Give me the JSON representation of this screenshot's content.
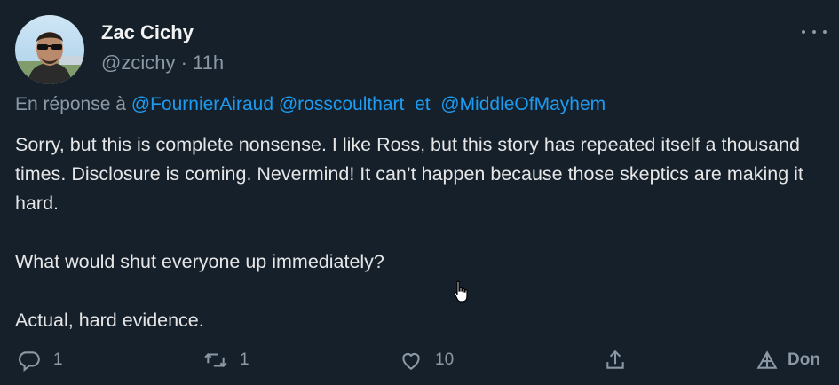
{
  "author": {
    "name": "Zac Cichy",
    "handle": "@zcichy",
    "time": "11h"
  },
  "reply_to": {
    "prefix": "En réponse à",
    "mentions": [
      "@FournierAiraud",
      "@rosscoulthart",
      "@MiddleOfMayhem"
    ],
    "conjunction": "et"
  },
  "tweet": {
    "paragraphs": [
      "Sorry, but this is complete nonsense. I like Ross, but this story has repeated itself a thousand times. Disclosure is coming. Nevermind! It can’t happen because those skeptics are making it hard.",
      "What would shut everyone up immediately?",
      "Actual, hard evidence."
    ]
  },
  "actions": {
    "reply_count": "1",
    "retweet_count": "1",
    "like_count": "10",
    "tip_label": "Don"
  },
  "colors": {
    "background": "#15202b",
    "link": "#1d9bf0",
    "muted": "#8b98a5"
  },
  "icons": [
    "more-icon",
    "reply-icon",
    "retweet-icon",
    "like-icon",
    "share-icon",
    "tip-icon",
    "cursor-icon"
  ]
}
